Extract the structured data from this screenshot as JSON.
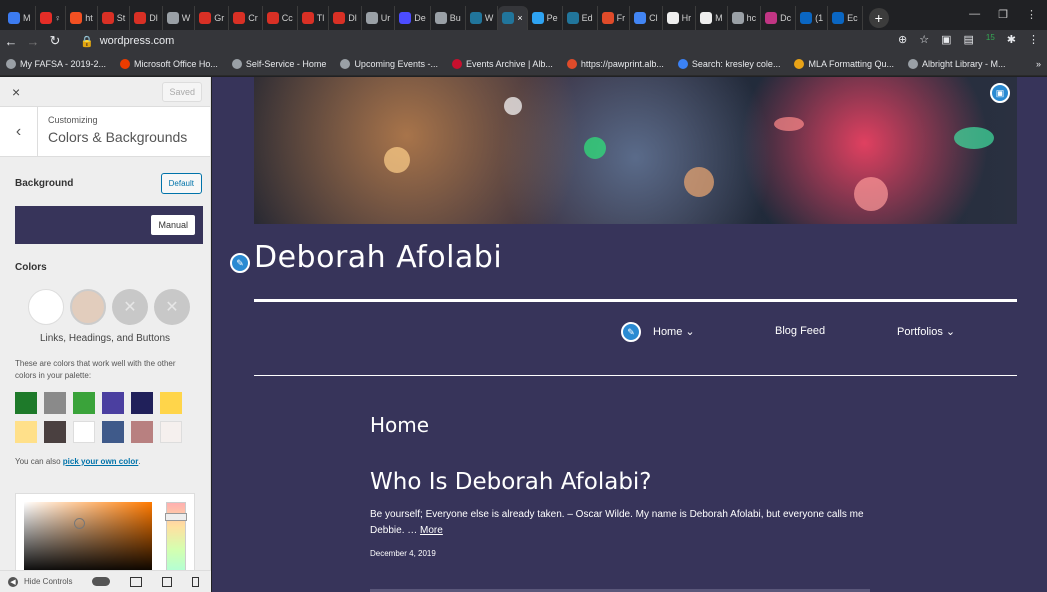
{
  "browser": {
    "tabs": [
      {
        "label": "M",
        "color": "#3c7bf0"
      },
      {
        "label": "♀",
        "color": "#e52d27"
      },
      {
        "label": "ht",
        "color": "#f25022"
      },
      {
        "label": "St",
        "color": "#d93025"
      },
      {
        "label": "Dl",
        "color": "#d93025"
      },
      {
        "label": "W",
        "color": "#9aa0a6"
      },
      {
        "label": "Gr",
        "color": "#d93025"
      },
      {
        "label": "Cr",
        "color": "#d93025"
      },
      {
        "label": "Cc",
        "color": "#d93025"
      },
      {
        "label": "Tl",
        "color": "#d93025"
      },
      {
        "label": "Dl",
        "color": "#d93025"
      },
      {
        "label": "Ur",
        "color": "#9aa0a6"
      },
      {
        "label": "De",
        "color": "#4c4cff"
      },
      {
        "label": "Bu",
        "color": "#9aa0a6"
      },
      {
        "label": "W",
        "color": "#21759b"
      },
      {
        "label": "×",
        "color": "#21759b"
      },
      {
        "label": "Pe",
        "color": "#2ea3f2"
      },
      {
        "label": "Ed",
        "color": "#21759b"
      },
      {
        "label": "Fr",
        "color": "#e04b2a"
      },
      {
        "label": "Cl",
        "color": "#4285f4"
      },
      {
        "label": "Hr",
        "color": "#eeeeee"
      },
      {
        "label": "M",
        "color": "#eeeeee"
      },
      {
        "label": "hc",
        "color": "#9aa0a6"
      },
      {
        "label": "Dc",
        "color": "#c13584"
      },
      {
        "label": "(1",
        "color": "#0a66c2"
      },
      {
        "label": "Ec",
        "color": "#0a66c2"
      }
    ],
    "url": "wordpress.com",
    "bookmarks": [
      {
        "label": "My FAFSA - 2019-2...",
        "color": "#9aa0a6"
      },
      {
        "label": "Microsoft Office Ho...",
        "color": "#eb3c00"
      },
      {
        "label": "Self-Service - Home",
        "color": "#9aa0a6"
      },
      {
        "label": "Upcoming Events -...",
        "color": "#9aa0a6"
      },
      {
        "label": "Events Archive | Alb...",
        "color": "#c8102e"
      },
      {
        "label": "https://pawprint.alb...",
        "color": "#e04b2a"
      },
      {
        "label": "Search: kresley cole...",
        "color": "#3b82f6"
      },
      {
        "label": "MLA Formatting Qu...",
        "color": "#e8a317"
      },
      {
        "label": "Albright Library - M...",
        "color": "#9aa0a6"
      }
    ],
    "overflow": "»",
    "ext_badge": "15"
  },
  "customizer": {
    "close": "×",
    "saved": "Saved",
    "back": "‹",
    "crumb": "Customizing",
    "section": "Colors & Backgrounds",
    "background_label": "Background",
    "default_button": "Default",
    "manual_button": "Manual",
    "colors_label": "Colors",
    "circles_caption": "Links, Headings, and Buttons",
    "help_text": "These are colors that work well with the other colors in your palette:",
    "pick_prefix": "You can also",
    "pick_link": "pick your own color",
    "pick_suffix": ".",
    "hide_controls": "Hide Controls",
    "swatches": [
      "#1e7a2a",
      "#8a8a8a",
      "#3aa33a",
      "#4b3fa0",
      "#20205a",
      "#ffd54a",
      "#ffe08a",
      "#4a4040",
      "#ffffff",
      "#3f5a8a",
      "#b88080",
      "#f5f0ee"
    ],
    "circle_colors": [
      "#ffffff",
      "#e2cdbd",
      "#c8c8c8",
      "#c8c8c8"
    ],
    "background_color": "#37345a"
  },
  "preview": {
    "site_title": "Deborah Afolabi",
    "menu": {
      "home": "Home ⌄",
      "blog": "Blog Feed",
      "portfolios": "Portfolios ⌄"
    },
    "page_heading": "Home",
    "post_title": "Who Is Deborah Afolabi?",
    "excerpt": "Be yourself; Everyone else is already taken. – Oscar Wilde. My name is Deborah Afolabi, but everyone calls me Debbie. …",
    "more_link": "More",
    "post_date": "December 4, 2019"
  }
}
